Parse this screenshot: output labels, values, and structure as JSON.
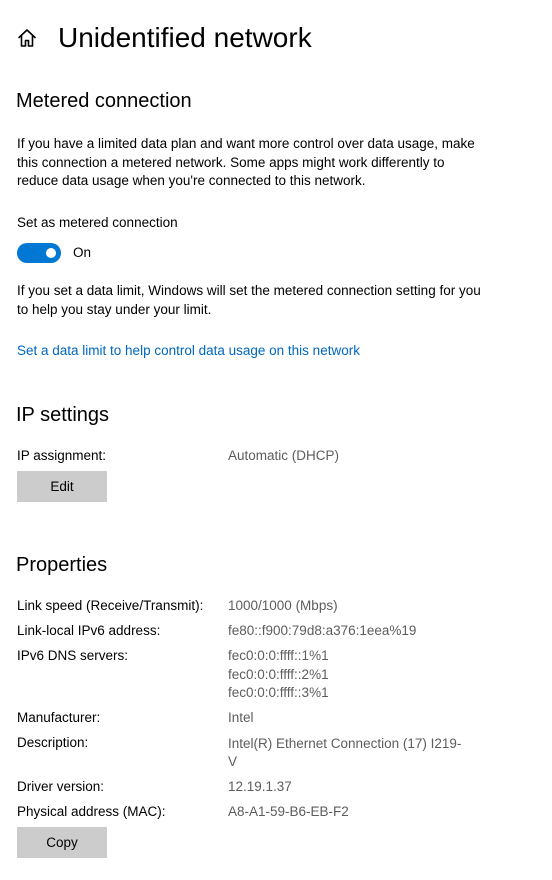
{
  "header": {
    "icon": "home-icon",
    "title": "Unidentified network"
  },
  "metered": {
    "title": "Metered connection",
    "description": "If you have a limited data plan and want more control over data usage, make this connection a metered network. Some apps might work differently to reduce data usage when you're connected to this network.",
    "setting_label": "Set as metered connection",
    "toggle_state": "On",
    "toggle_on": true,
    "limit_note": "If you set a data limit, Windows will set the metered connection setting for you to help you stay under your limit.",
    "limit_link": "Set a data limit to help control data usage on this network"
  },
  "ip_settings": {
    "title": "IP settings",
    "assignment_label": "IP assignment:",
    "assignment_value": "Automatic (DHCP)",
    "edit_button": "Edit"
  },
  "properties": {
    "title": "Properties",
    "link_speed_label": "Link speed (Receive/Transmit):",
    "link_speed_value": "1000/1000 (Mbps)",
    "ipv6_local_label": "Link-local IPv6 address:",
    "ipv6_local_value": "fe80::f900:79d8:a376:1eea%19",
    "dns_label": "IPv6 DNS servers:",
    "dns_values": [
      "fec0:0:0:ffff::1%1",
      "fec0:0:0:ffff::2%1",
      "fec0:0:0:ffff::3%1"
    ],
    "manufacturer_label": "Manufacturer:",
    "manufacturer_value": "Intel",
    "description_label": "Description:",
    "description_value": "Intel(R) Ethernet Connection (17) I219-V",
    "driver_label": "Driver version:",
    "driver_value": "12.19.1.37",
    "mac_label": "Physical address (MAC):",
    "mac_value": "A8-A1-59-B6-EB-F2",
    "copy_button": "Copy"
  },
  "colors": {
    "accent": "#0078d4",
    "link": "#0067c0",
    "value_text": "#5d5d5d",
    "button_bg": "#cccccc"
  }
}
